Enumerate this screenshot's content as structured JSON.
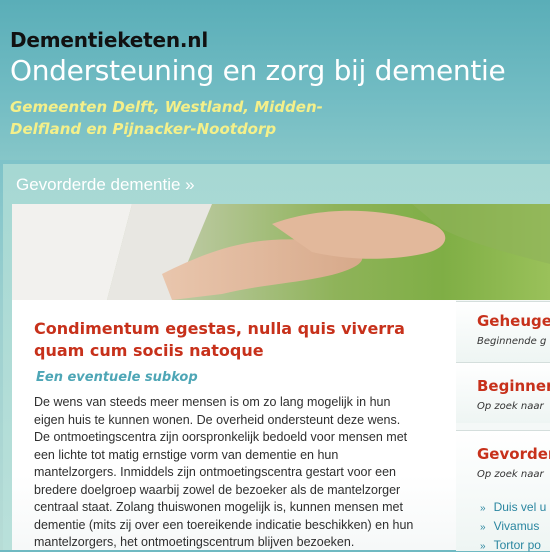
{
  "header": {
    "site_name": "Dementieketen.nl",
    "title": "Ondersteuning en zorg bij dementie",
    "subtitle": "Gemeenten Delft, Westland, Midden-Delfland en Pijnacker-Nootdorp"
  },
  "section": {
    "title": "Gevorderde dementie »"
  },
  "article": {
    "title": "Condimentum egestas, nulla quis viverra quam cum sociis natoque",
    "subtitle": "Een eventuele subkop",
    "body": "De wens van steeds meer mensen is om zo lang mogelijk in hun eigen huis te kunnen wonen. De overheid ondersteunt deze wens. De ontmoetingscentra zijn oorspronkelijk bedoeld voor mensen met een lichte tot matig ernstige vorm van dementie en hun mantelzorgers. Inmiddels zijn ontmoetingscentra gestart voor een bredere doelgroep waarbij zowel de bezoeker als de mantelzorger centraal staat. Zolang thuiswonen mogelijk is, kunnen mensen met dementie (mits zij over een toereikende indicatie beschikken) en hun mantelzorgers, het ontmoetingscentrum blijven bezoeken."
  },
  "sidebar": {
    "items": [
      {
        "title": "Geheuge",
        "subtitle": "Beginnende g"
      },
      {
        "title": "Beginner",
        "subtitle": "Op zoek naar"
      },
      {
        "title": "Gevorder",
        "subtitle": "Op zoek naar"
      }
    ],
    "links": [
      "Duis vel u",
      "Vivamus",
      "Tortor po"
    ]
  }
}
